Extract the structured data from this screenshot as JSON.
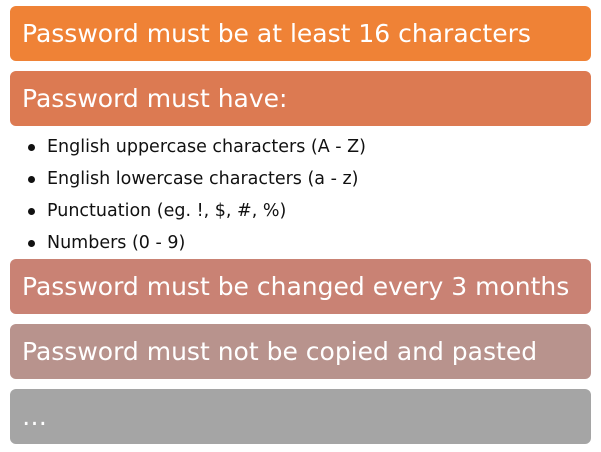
{
  "rules": [
    {
      "text": "Password must be at least 16 characters",
      "color": "#ef8236"
    },
    {
      "text": "Password must have:",
      "color": "#dc7a52"
    },
    {
      "text": "Password must be changed every 3 months",
      "color": "#c98274"
    },
    {
      "text": "Password must not be copied and pasted",
      "color": "#b8938d"
    },
    {
      "text": "…",
      "color": "#a5a5a5"
    }
  ],
  "requirements": [
    "English uppercase characters (A - Z)",
    "English lowercase characters (a - z)",
    "Punctuation (eg. !, $, #, %)",
    "Numbers (0 - 9)"
  ]
}
